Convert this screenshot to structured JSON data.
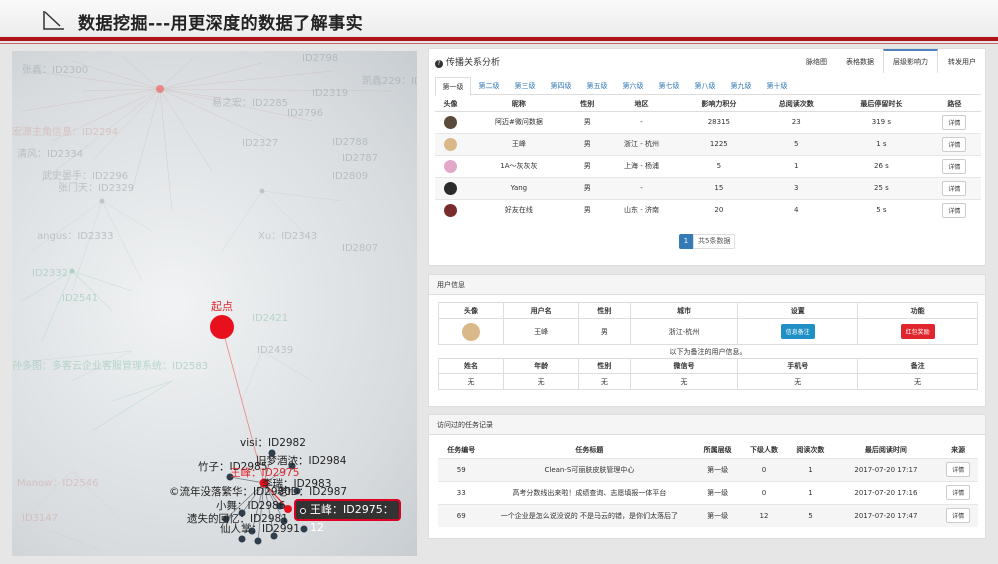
{
  "header": {
    "title": "数据挖掘---用更深度的数据了解事实"
  },
  "graph": {
    "start_label": "起点",
    "nodes": [
      {
        "label": "visi：ID2982"
      },
      {
        "label": "旧梦酒浓：ID2984"
      },
      {
        "label": "竹子：ID2985"
      },
      {
        "label": "王峰：ID2975"
      },
      {
        "label": "李瑞：ID2983"
      },
      {
        "label": "©流年没落繁华：ID2980"
      },
      {
        "label": "老ID：ID2987"
      },
      {
        "label": "小舞：ID2986"
      },
      {
        "label": "遗失的回忆：ID2981"
      },
      {
        "label": "仙人掌：ID2991"
      }
    ],
    "background_labels": [
      {
        "text": "ID2798"
      },
      {
        "text": "凯鑫229：ID"
      },
      {
        "text": "ID2319"
      },
      {
        "text": "张鑫：ID2300"
      },
      {
        "text": "易之宏：ID2285"
      },
      {
        "text": "ID2796"
      },
      {
        "text": "宏源主角信息：ID2294"
      },
      {
        "text": "ID2788"
      },
      {
        "text": "清风：ID2334"
      },
      {
        "text": "ID2327"
      },
      {
        "text": "ID2787"
      },
      {
        "text": "武史晏手：ID2296"
      },
      {
        "text": "ID2809"
      },
      {
        "text": "张门天：ID2329"
      },
      {
        "text": "angus：ID2333"
      },
      {
        "text": "Xu：ID2343"
      },
      {
        "text": "ID2807"
      },
      {
        "text": "ID2332"
      },
      {
        "text": "ID2439"
      },
      {
        "text": "ID2421"
      },
      {
        "text": "孙多图：多客云企业客服管理系统：ID2583"
      },
      {
        "text": "ID2541"
      },
      {
        "text": "Manow：ID2546"
      },
      {
        "text": "ID3147"
      }
    ],
    "tooltip": "王峰：ID2975：12"
  },
  "spread": {
    "title": "传播关系分析",
    "view_tabs": [
      "脉络图",
      "表格数据",
      "层级影响力",
      "转发用户"
    ],
    "active_view": "层级影响力",
    "level_tabs": [
      "第一级",
      "第二级",
      "第三级",
      "第四级",
      "第五级",
      "第六级",
      "第七级",
      "第八级",
      "第九级",
      "第十级"
    ],
    "headers": [
      "头像",
      "昵称",
      "性别",
      "地区",
      "影响力积分",
      "总阅读次数",
      "最后停留时长",
      "路径"
    ],
    "rows": [
      {
        "avatar_color": "#5a4a3a",
        "name": "阿迈#微问数据",
        "gender": "男",
        "region": "-",
        "score": "28315",
        "reads": "23",
        "stay": "319 s",
        "path": "详情"
      },
      {
        "avatar_color": "#d9b98a",
        "name": "王峰",
        "gender": "男",
        "region": "浙江 - 杭州",
        "score": "1225",
        "reads": "5",
        "stay": "1 s",
        "path": "详情"
      },
      {
        "avatar_color": "#e2a7c9",
        "name": "1A～灰灰灰",
        "gender": "男",
        "region": "上海 - 杨浦",
        "score": "5",
        "reads": "1",
        "stay": "26 s",
        "path": "详情"
      },
      {
        "avatar_color": "#2b2b2b",
        "name": "Yang",
        "gender": "男",
        "region": "-",
        "score": "15",
        "reads": "3",
        "stay": "25 s",
        "path": "详情"
      },
      {
        "avatar_color": "#7a2b2b",
        "name": "好友在线",
        "gender": "男",
        "region": "山东 - 济南",
        "score": "20",
        "reads": "4",
        "stay": "5 s",
        "path": "详情"
      }
    ],
    "pager": {
      "page": "1",
      "info": "共5条数据"
    }
  },
  "user_info": {
    "title": "用户信息",
    "headers": [
      "头像",
      "用户名",
      "性别",
      "城市",
      "设置",
      "功能"
    ],
    "user": {
      "avatar_color": "#d9b98a",
      "name": "王峰",
      "gender": "男",
      "city": "浙江-杭州",
      "setting_btn": "信息备注",
      "func_btn": "红包奖励"
    },
    "note": "以下为备注的用户信息。",
    "note_headers": [
      "姓名",
      "年龄",
      "性别",
      "微信号",
      "手机号",
      "备注"
    ],
    "note_values": [
      "无",
      "无",
      "无",
      "无",
      "无",
      "无"
    ]
  },
  "tasks": {
    "title": "访问过的任务记录",
    "headers": [
      "任务编号",
      "任务标题",
      "所属层级",
      "下级人数",
      "阅读次数",
      "最后阅读时间",
      "来源"
    ],
    "rows": [
      {
        "id": "59",
        "title": "Clean-S可丽肤皮肤管理中心",
        "level": "第一级",
        "sub": "0",
        "reads": "1",
        "time": "2017-07-20 17:17",
        "source": "详情"
      },
      {
        "id": "33",
        "title": "高考分数线出来啦！成绩查询、志愿填报一体平台",
        "level": "第一级",
        "sub": "0",
        "reads": "1",
        "time": "2017-07-20 17:16",
        "source": "详情"
      },
      {
        "id": "69",
        "title": "一个企业是怎么说没说的 不是马云的错，是你们太落后了",
        "level": "第一级",
        "sub": "12",
        "reads": "5",
        "time": "2017-07-20 17:47",
        "source": "详情"
      }
    ]
  }
}
